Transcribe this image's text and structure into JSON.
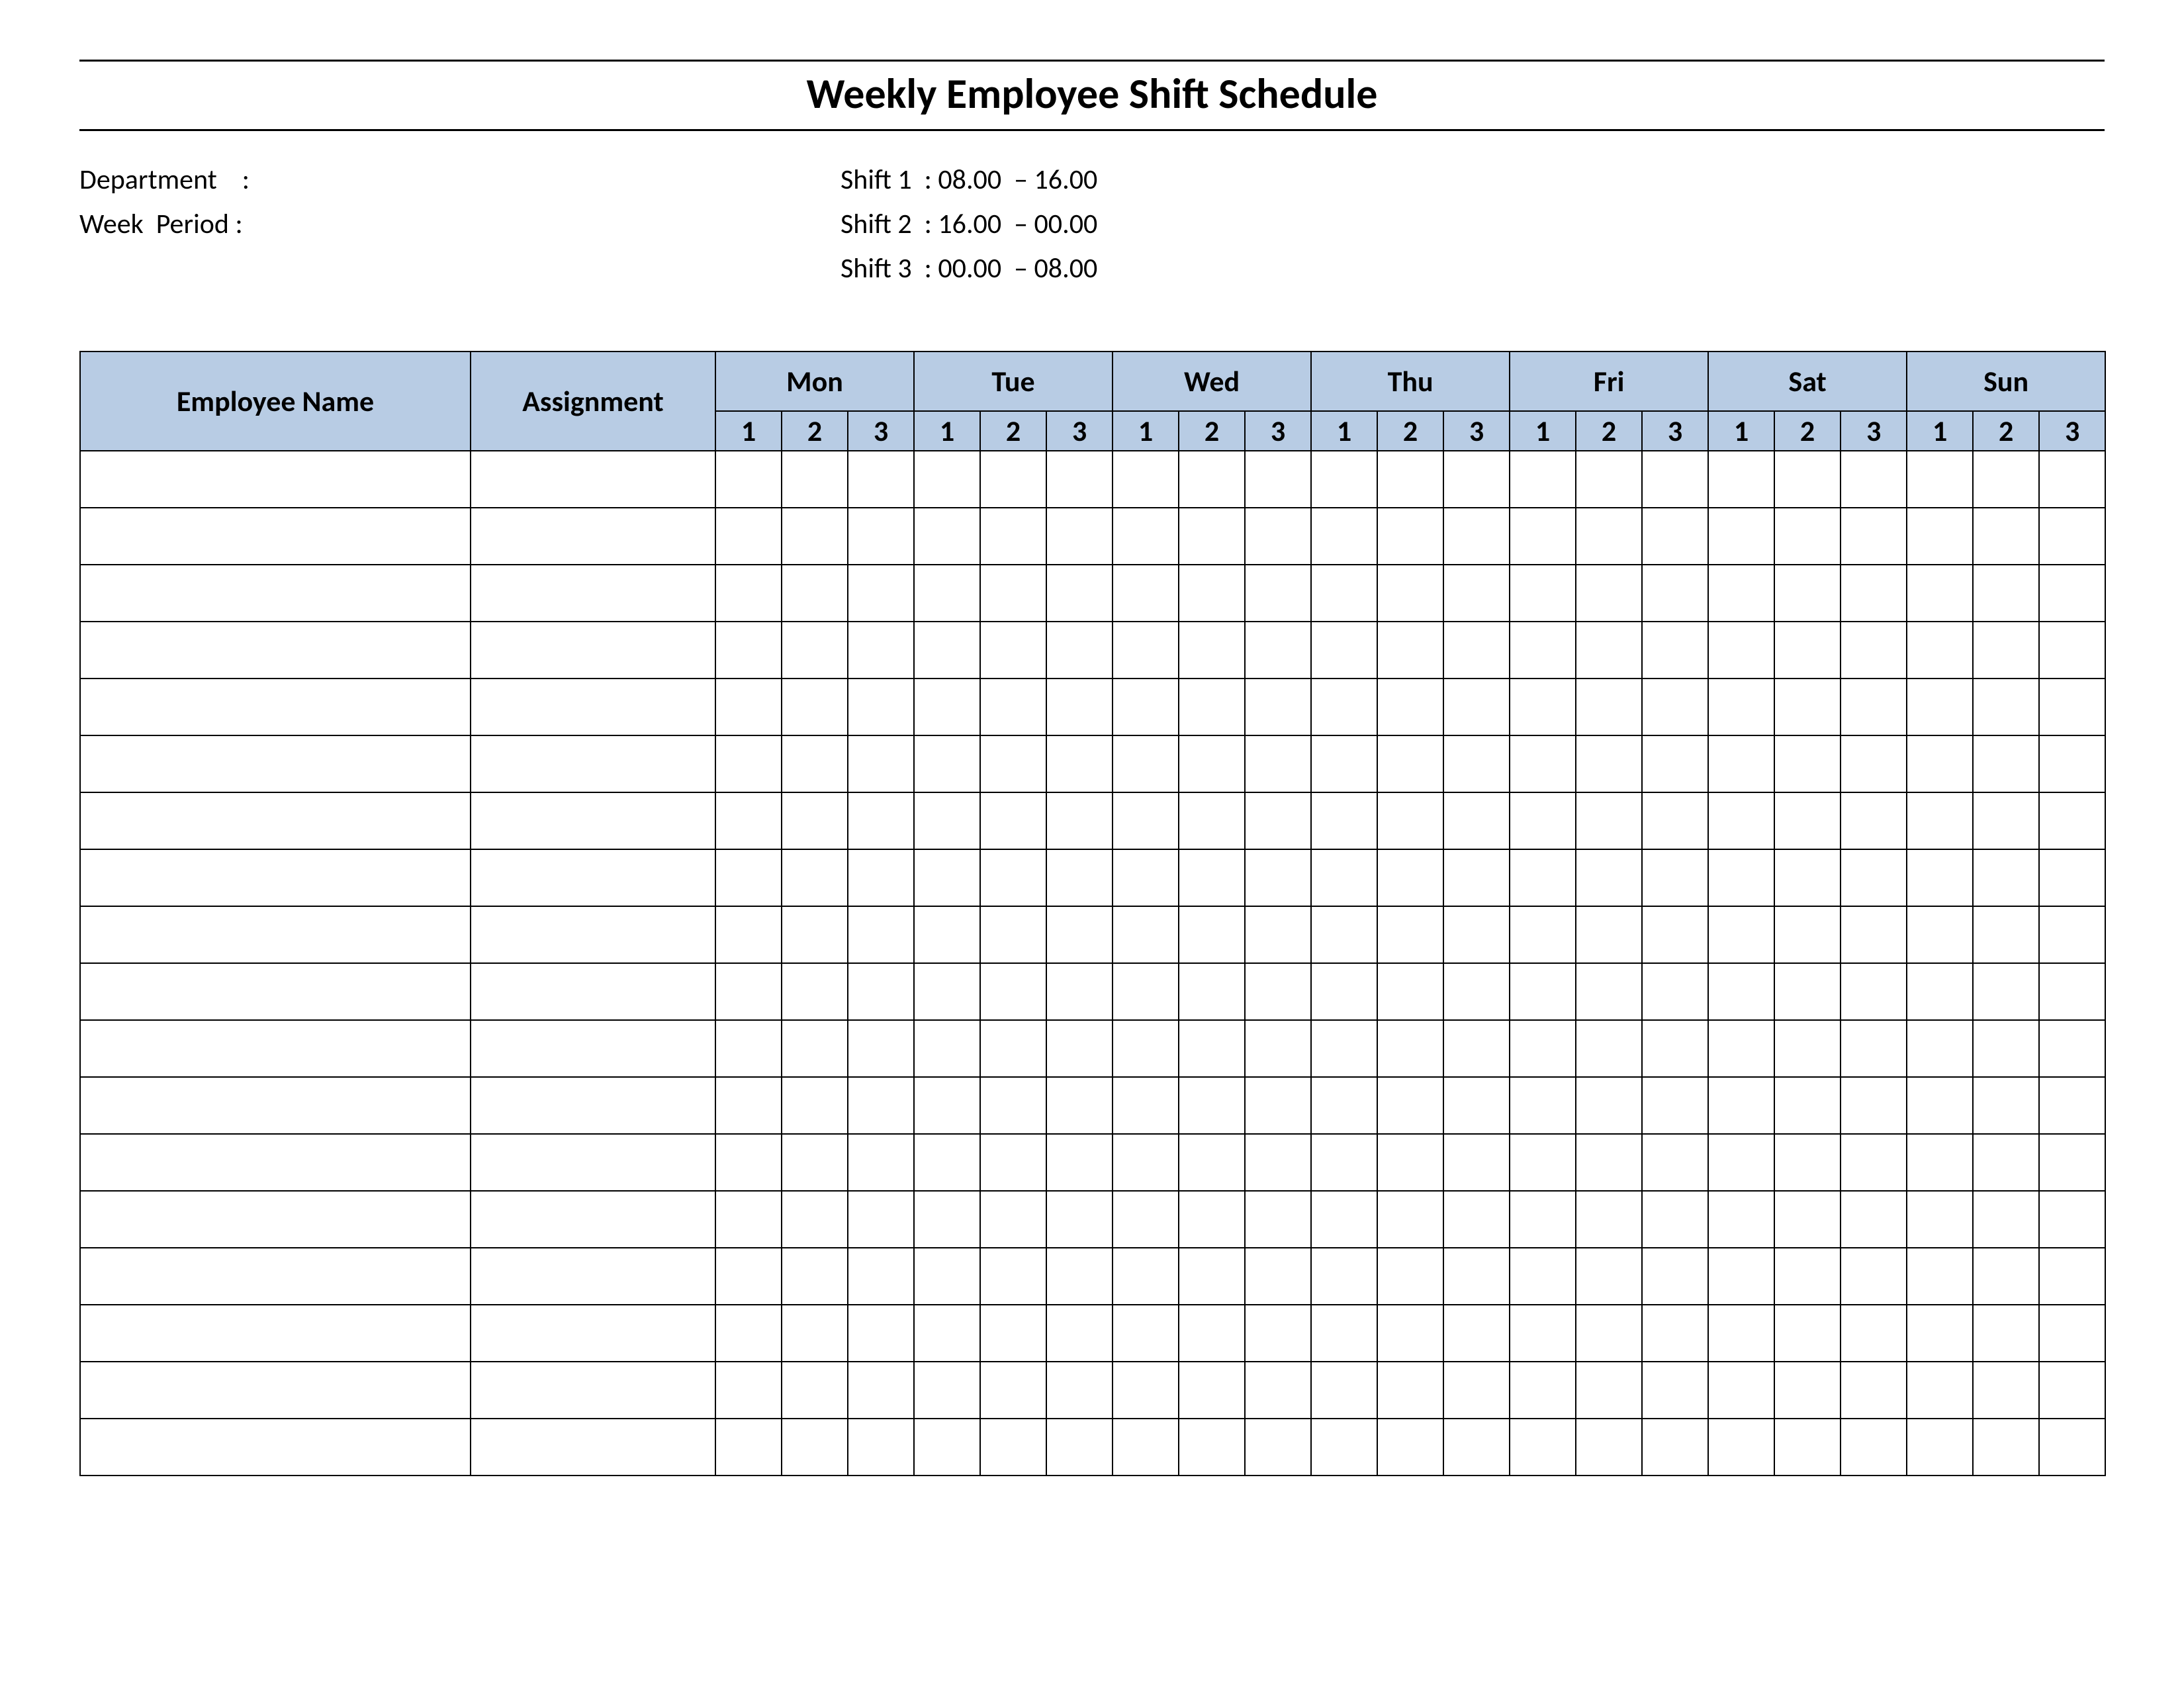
{
  "title": "Weekly Employee Shift Schedule",
  "meta": {
    "department_label": "Department    :",
    "department_value": "",
    "week_period_label": "Week  Period :",
    "week_period_value": "",
    "shift1": "Shift 1  : 08.00  – 16.00",
    "shift2": "Shift 2  : 16.00  – 00.00",
    "shift3": "Shift 3  : 00.00  – 08.00"
  },
  "headers": {
    "employee_name": "Employee Name",
    "assignment": "Assignment",
    "days": [
      "Mon",
      "Tue",
      "Wed",
      "Thu",
      "Fri",
      "Sat",
      "Sun"
    ],
    "shifts": [
      "1",
      "2",
      "3"
    ]
  },
  "body_row_count": 18
}
